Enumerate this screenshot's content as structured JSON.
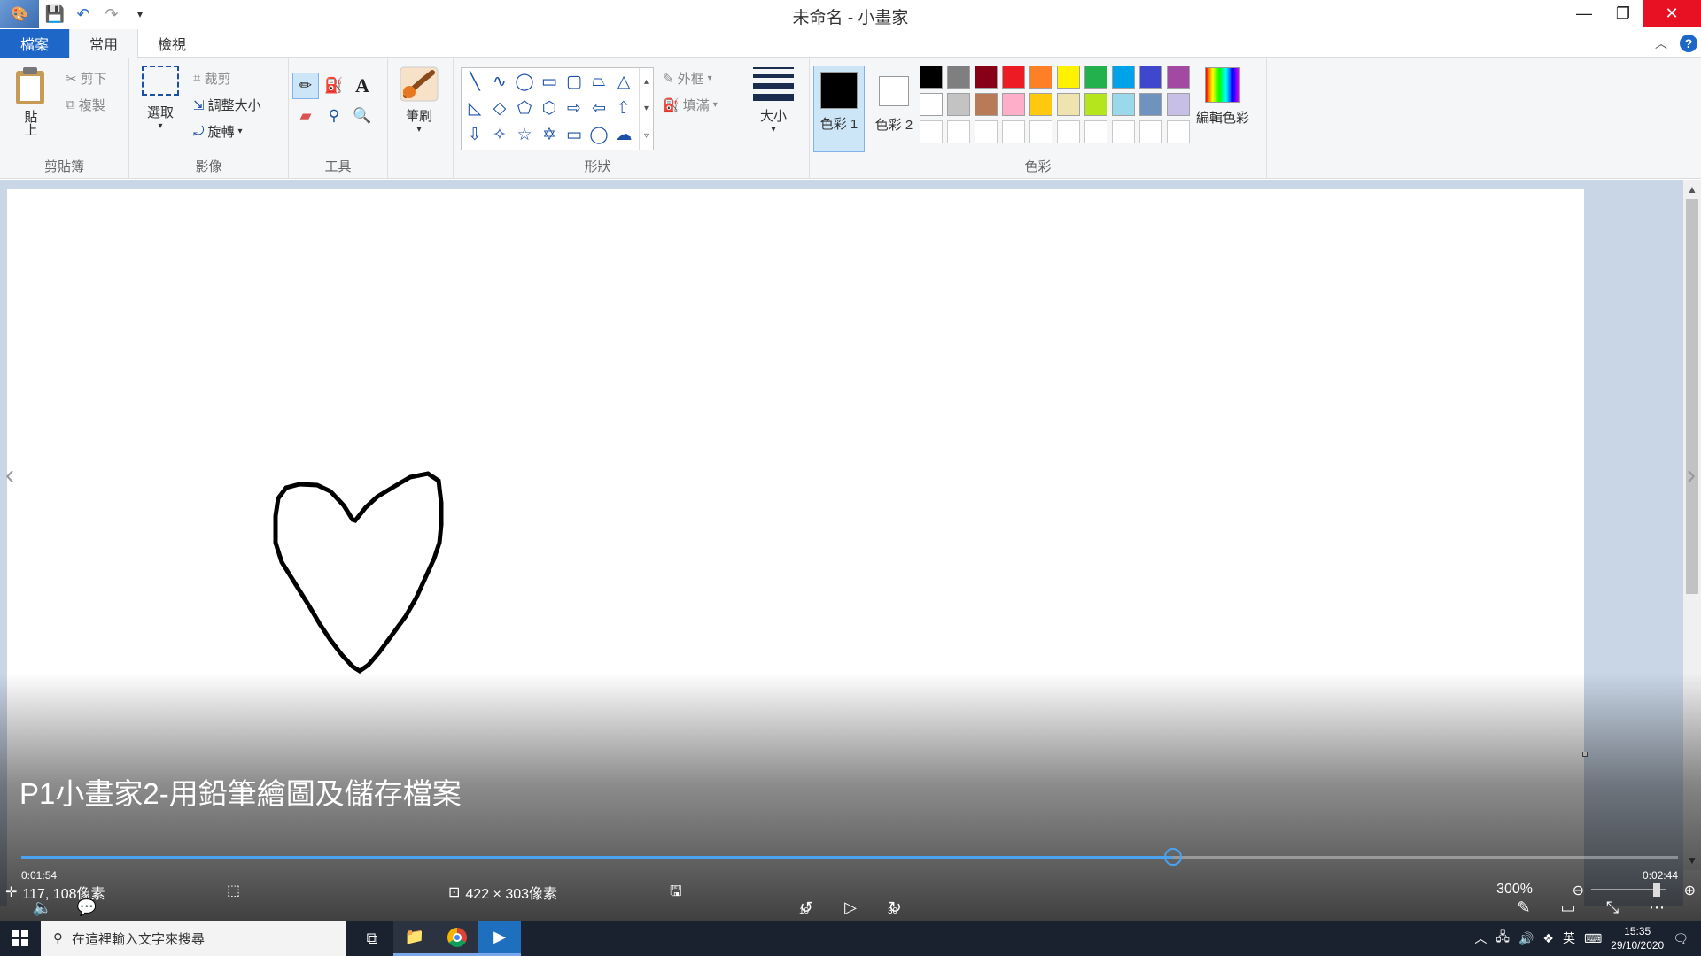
{
  "window": {
    "title": "未命名 - 小畫家"
  },
  "tabs": {
    "file": "檔案",
    "home": "常用",
    "view": "檢視"
  },
  "ribbon": {
    "clipboard": {
      "label": "剪貼簿",
      "paste": "貼上",
      "cut": "剪下",
      "copy": "複製"
    },
    "image": {
      "label": "影像",
      "select": "選取",
      "crop": "裁剪",
      "resize": "調整大小",
      "rotate": "旋轉"
    },
    "tools": {
      "label": "工具"
    },
    "brushes": {
      "label": "筆刷"
    },
    "shapes": {
      "label": "形狀",
      "outline": "外框",
      "fill": "填滿"
    },
    "size": {
      "label": "大小"
    },
    "colors": {
      "label": "色彩",
      "color1": "色彩 1",
      "color2": "色彩 2",
      "edit": "編輯色彩",
      "color1_value": "#000000",
      "color2_value": "#ffffff",
      "palette": [
        "#000000",
        "#7f7f7f",
        "#880015",
        "#ed1c24",
        "#ff7f27",
        "#fff200",
        "#22b14c",
        "#00a2e8",
        "#3f48cc",
        "#a349a4",
        "#ffffff",
        "#c3c3c3",
        "#b97a57",
        "#ffaec9",
        "#ffc90e",
        "#efe4b0",
        "#b5e61d",
        "#99d9ea",
        "#7092be",
        "#c8bfe7",
        "#ffffff",
        "#ffffff",
        "#ffffff",
        "#ffffff",
        "#ffffff",
        "#ffffff",
        "#ffffff",
        "#ffffff",
        "#ffffff",
        "#ffffff"
      ]
    }
  },
  "video": {
    "title": "P1小畫家2-用鉛筆繪圖及儲存檔案",
    "current_time": "0:01:54",
    "total_time": "0:02:44",
    "progress": 0.695,
    "rewind_label": "10",
    "forward_label": "30"
  },
  "status": {
    "cursor_pos": "117, 108像素",
    "canvas_size": "422 × 303像素",
    "zoom": "300%"
  },
  "taskbar": {
    "search_placeholder": "在這裡輸入文字來搜尋",
    "ime": "英",
    "time": "15:35",
    "date": "29/10/2020"
  }
}
